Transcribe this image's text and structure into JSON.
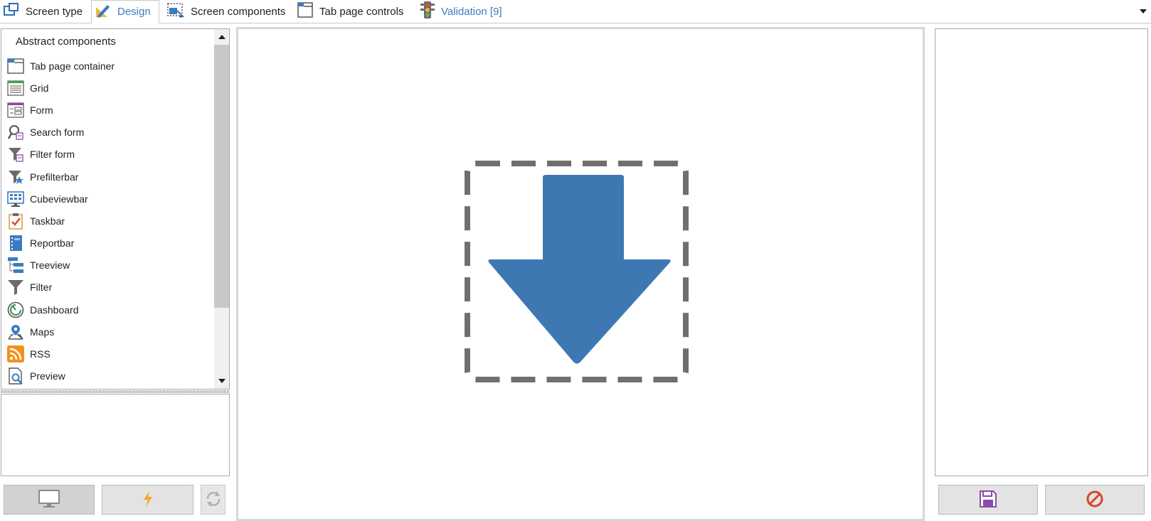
{
  "tabs": [
    {
      "label": "Screen type",
      "icon": "screen-type-icon"
    },
    {
      "label": "Design",
      "icon": "design-pencil-icon"
    },
    {
      "label": "Screen components",
      "icon": "screen-components-icon"
    },
    {
      "label": "Tab page controls",
      "icon": "tab-page-controls-icon"
    },
    {
      "label": "Validation [9]",
      "icon": "traffic-light-icon"
    }
  ],
  "active_tab": "Design",
  "components_panel": {
    "header": "Abstract components",
    "items": [
      {
        "label": "Tab page container",
        "icon": "tab-page-container-icon"
      },
      {
        "label": "Grid",
        "icon": "grid-icon"
      },
      {
        "label": "Form",
        "icon": "form-icon"
      },
      {
        "label": "Search form",
        "icon": "search-form-icon"
      },
      {
        "label": "Filter form",
        "icon": "filter-form-icon"
      },
      {
        "label": "Prefilterbar",
        "icon": "prefilterbar-icon"
      },
      {
        "label": "Cubeviewbar",
        "icon": "cubeviewbar-icon"
      },
      {
        "label": "Taskbar",
        "icon": "taskbar-icon"
      },
      {
        "label": "Reportbar",
        "icon": "reportbar-icon"
      },
      {
        "label": "Treeview",
        "icon": "treeview-icon"
      },
      {
        "label": "Filter",
        "icon": "filter-icon"
      },
      {
        "label": "Dashboard",
        "icon": "dashboard-icon"
      },
      {
        "label": "Maps",
        "icon": "maps-icon"
      },
      {
        "label": "RSS",
        "icon": "rss-icon"
      },
      {
        "label": "Preview",
        "icon": "preview-icon"
      }
    ]
  },
  "left_buttons": [
    {
      "icon": "monitor-icon"
    },
    {
      "icon": "lightning-icon"
    },
    {
      "icon": "refresh-icon"
    }
  ],
  "canvas": {
    "icon": "drop-here-arrow-icon"
  },
  "right_buttons": [
    {
      "icon": "save-icon"
    },
    {
      "icon": "cancel-icon"
    }
  ],
  "colors": {
    "accent": "#3b7cc0",
    "arrow": "#3e78b3",
    "dashed_border": "#6f6f6f",
    "cancel_red": "#d6452b",
    "save_purple": "#8a4ba8",
    "lightning_orange": "#f5a623"
  }
}
